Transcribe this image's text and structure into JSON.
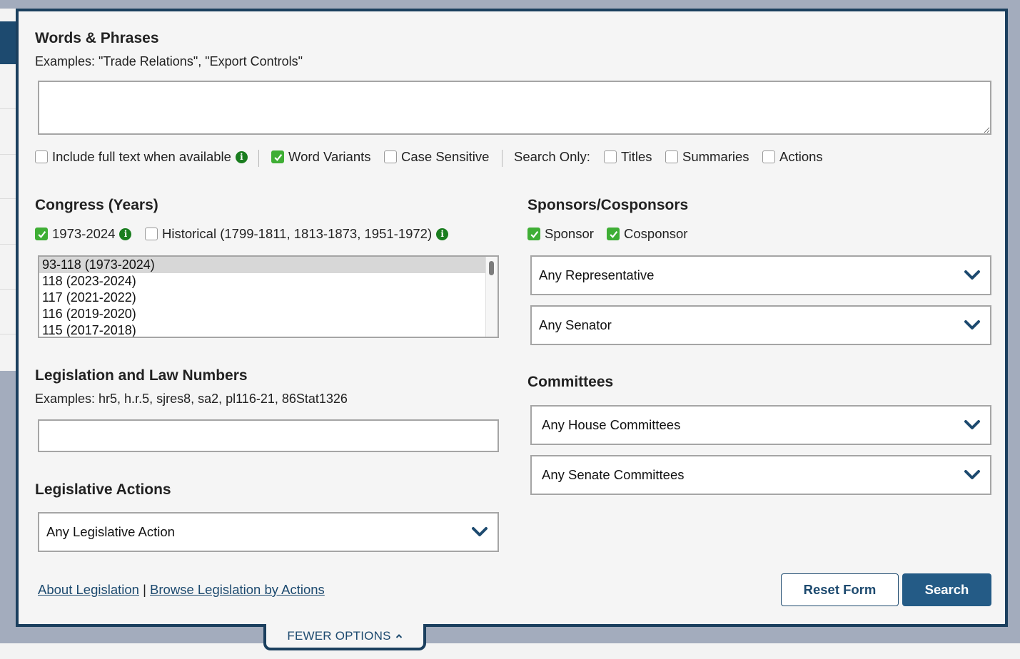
{
  "words": {
    "heading": "Words & Phrases",
    "examples": "Examples: \"Trade Relations\", \"Export Controls\"",
    "value": "",
    "options": {
      "full_text": {
        "label": "Include full text when available",
        "checked": false
      },
      "word_variants": {
        "label": "Word Variants",
        "checked": true
      },
      "case_sensitive": {
        "label": "Case Sensitive",
        "checked": false
      },
      "search_only_label": "Search Only:",
      "titles": {
        "label": "Titles",
        "checked": false
      },
      "summaries": {
        "label": "Summaries",
        "checked": false
      },
      "actions": {
        "label": "Actions",
        "checked": false
      }
    },
    "info_icon": "info-circle-icon"
  },
  "congress": {
    "heading": "Congress (Years)",
    "current": {
      "label": "1973-2024",
      "checked": true
    },
    "historical": {
      "label": "Historical (1799-1811, 1813-1873, 1951-1972)",
      "checked": false
    },
    "options": [
      "93-118 (1973-2024)",
      "118 (2023-2024)",
      "117 (2021-2022)",
      "116 (2019-2020)",
      "115 (2017-2018)"
    ],
    "selected_index": 0
  },
  "legislation_numbers": {
    "heading": "Legislation and Law Numbers",
    "examples": "Examples: hr5, h.r.5, sjres8, sa2, pl116-21, 86Stat1326",
    "value": ""
  },
  "legislative_actions": {
    "heading": "Legislative Actions",
    "selected": "Any Legislative Action"
  },
  "sponsors": {
    "heading": "Sponsors/Cosponsors",
    "sponsor": {
      "label": "Sponsor",
      "checked": true
    },
    "cosponsor": {
      "label": "Cosponsor",
      "checked": true
    },
    "representative": "Any Representative",
    "senator": "Any Senator"
  },
  "committees": {
    "heading": "Committees",
    "house": "Any House Committees",
    "senate": "Any Senate Committees"
  },
  "footer": {
    "about_link": "About Legislation",
    "divider": "|",
    "browse_link": "Browse Legislation by Actions",
    "reset_label": "Reset Form",
    "search_label": "Search",
    "fewer_options": "FEWER OPTIONS"
  },
  "colors": {
    "navy": "#1b3f5e",
    "button_blue": "#245b86",
    "check_green": "#3fae35",
    "info_green": "#1a7d1f",
    "background": "#a3acbd"
  }
}
